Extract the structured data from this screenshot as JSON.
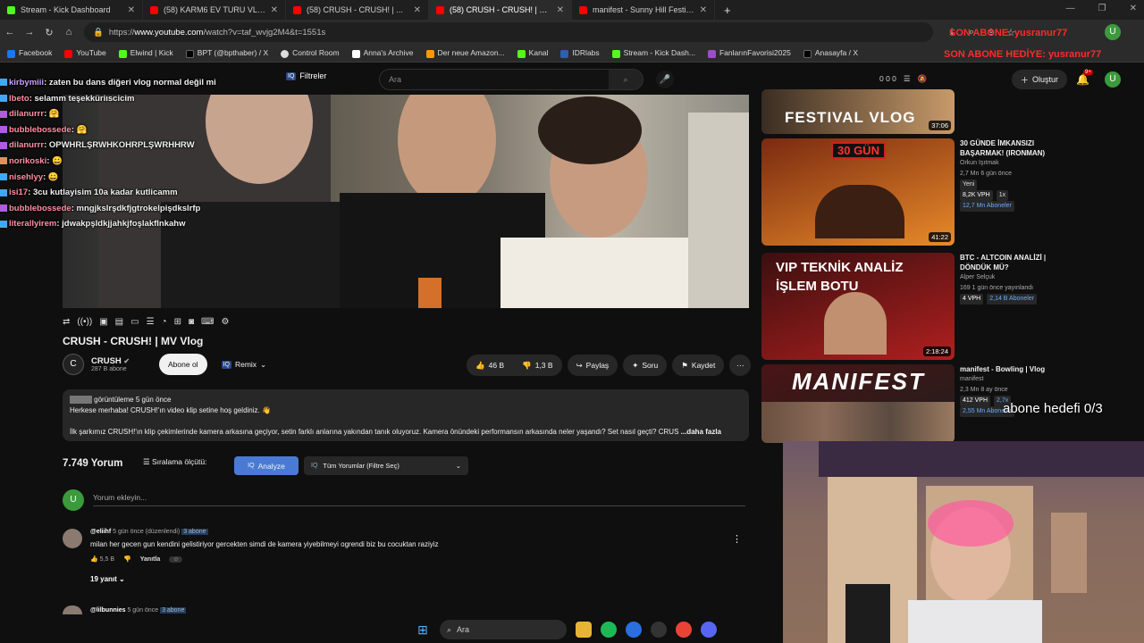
{
  "browser": {
    "tabs": [
      {
        "label": "Stream - Kick Dashboard",
        "color": "#53fc18",
        "active": false
      },
      {
        "label": "(58) KARM6 EV TURU VLOG !? | ...",
        "color": "#ff0000",
        "active": false
      },
      {
        "label": "(58) CRUSH - CRUSH! | ...",
        "color": "#ff0000",
        "active": false
      },
      {
        "label": "(58) CRUSH - CRUSH! | MV Vlog",
        "color": "#ff0000",
        "active": true
      },
      {
        "label": "manifest - Sunny Hill Festival Vl...",
        "color": "#ff0000",
        "active": false
      }
    ],
    "url_prefix": "https://",
    "url_host": "www.youtube.com",
    "url_path": "/watch?v=taf_wvjg2M4&t=1551s",
    "bookmarks": [
      {
        "label": "Facebook",
        "color": "#1877f2"
      },
      {
        "label": "YouTube",
        "color": "#ff0000"
      },
      {
        "label": "Elwind | Kick",
        "color": "#53fc18"
      },
      {
        "label": "BPT (@bpthaber) / X",
        "color": "#000000"
      },
      {
        "label": "Control Room",
        "color": "#ffffff"
      },
      {
        "label": "Anna's Archive",
        "color": "#ffffff"
      },
      {
        "label": "Der neue Amazon...",
        "color": "#ff9900"
      },
      {
        "label": "Kanal",
        "color": "#53fc18"
      },
      {
        "label": "IDRlabs",
        "color": "#2d5fb5"
      },
      {
        "label": "Stream - Kick Dash...",
        "color": "#53fc18"
      },
      {
        "label": "FanlarınFavorisi2025",
        "color": "#9b4dca"
      },
      {
        "label": "Anasayfa / X",
        "color": "#000000"
      }
    ]
  },
  "overlay": {
    "son_abone": "SON ABONE: yusranur77",
    "son_abone_hediye": "SON ABONE HEDİYE: yusranur77",
    "abone_hedefi": "abone hedefi 0/3"
  },
  "chat": [
    {
      "user": "kirbymiii",
      "msg": ": zaten bu dans diğeri vlog normal değil mi",
      "color": "#c9a0ff"
    },
    {
      "user": "lbeto",
      "msg": ": selamm teşekküriıscicim",
      "color": "#ff8fa3"
    },
    {
      "user": "dilanurrr",
      "msg": ": 🤗",
      "color": "#ff8fa3"
    },
    {
      "user": "bubblebossede",
      "msg": ": 🤗",
      "color": "#ff8fa3"
    },
    {
      "user": "dilanurrr",
      "msg": ": OPWHRLŞRWHKOHRPLŞWRHHRW",
      "color": "#ff8fa3"
    },
    {
      "user": "norikoski",
      "msg": ": 😀",
      "color": "#ff8fa3"
    },
    {
      "user": "nisehlyy",
      "msg": ": 😀",
      "color": "#ff8fa3"
    },
    {
      "user": "isi17",
      "msg": ": 3cu kutlayisim 10a kadar kutlicamm",
      "color": "#ff8fa3"
    },
    {
      "user": "bubblebossede",
      "msg": ": mngjkslrşdkfjgtrokelpişdkslrfp",
      "color": "#ff8fa3"
    },
    {
      "user": "literallyirem",
      "msg": ": jdwakpşldkjjahkjfoşlakflnkahw",
      "color": "#ff8fa3"
    }
  ],
  "header": {
    "filter_label": "Filtreler",
    "search_placeholder": "Ara",
    "stats": "0  0  0",
    "create_label": "Oluştur",
    "notif_count": "9+",
    "avatar_letter": "U"
  },
  "video": {
    "title": "CRUSH - CRUSH! | MV Vlog",
    "channel": "CRUSH",
    "subs": "287 B abone",
    "subscribe_label": "Abone ol",
    "remix_label": "Remix",
    "likes": "46 B",
    "dislikes": "1,3 B",
    "share_label": "Paylaş",
    "ask_label": "Soru",
    "save_label": "Kaydet",
    "views_suffix": "görüntüleme  5 gün önce",
    "desc_line1": "Herkese merhaba! CRUSH!'ın video klip setine hoş geldiniz. 👋",
    "desc_line2": "İlk şarkımız CRUSH!'ın klip çekimlerinde kamera arkasına geçiyor, setin farklı anlarına yakından tanık oluyoruz. Kamera önündeki performansın arkasında neler yaşandı? Set nasıl geçti? CRUS",
    "desc_more": "...daha fazla"
  },
  "comments": {
    "count": "7.749 Yorum",
    "sort_label": "Sıralama ölçütü:",
    "analyze_label": "Analyze",
    "filter_select": "Tüm Yorumlar (Filtre Seç)",
    "add_placeholder": "Yorum ekleyin...",
    "items": [
      {
        "user": "@eliihf",
        "meta": "5 gün önce (düzenlendi)",
        "badge": "3 abone",
        "text": "milan her gecen gun kendini gelistiriyor gercekten simdi de kamera yiyebilmeyi ogrendi biz bu cocuktan raziyiz",
        "likes": "5,5 B",
        "reply": "Yanıtla",
        "replies": "19 yanıt"
      },
      {
        "user": "@lilbunnies",
        "meta": "5 gün önce",
        "badge": "3 abone"
      }
    ]
  },
  "sidebar": [
    {
      "thumb_text": "FESTIVAL VLOG",
      "duration": "37:06",
      "title": "",
      "channel": "",
      "stats": "",
      "grad": "#3a2d22,#c79a6a"
    },
    {
      "thumb_text": "30 GÜN",
      "duration": "41:22",
      "title": "30 GÜNDE İMKANSIZI BAŞARMAK! (IRONMAN)",
      "channel": "Orkun Işıtmak",
      "stats": "2,7 Mn  6 gün önce",
      "chip1": "Yeni",
      "chip2": "8,2K VPH",
      "chip3": "1x",
      "chip4": "12,7 Mn Aboneler",
      "grad": "#7a2a10,#e88a2a"
    },
    {
      "thumb_text": "VIP TEKNİK ANALİZ İŞLEM BOTU",
      "duration": "2:18:24",
      "title": "BTC - ALTCOIN ANALİZİ | DÖNDÜK MÜ?",
      "channel": "Alper Selçuk",
      "stats": "169  1 gün önce yayınlandı",
      "chip1": "4 VPH",
      "chip2": "2,14 B Aboneler",
      "grad": "#3b0f0f,#b01f1f"
    },
    {
      "thumb_text": "MANIFEST",
      "duration": "",
      "title": "manifest - Bowling | Vlog",
      "channel": "manifest",
      "stats": "2,3 Mn  8 ay önce",
      "chip1": "412 VPH",
      "chip2": "2,7x",
      "chip3": "2,55 Mn Aboneler",
      "grad": "#4a1414,#1e1e1e"
    }
  ],
  "taskbar": {
    "search_label": "Ara"
  }
}
